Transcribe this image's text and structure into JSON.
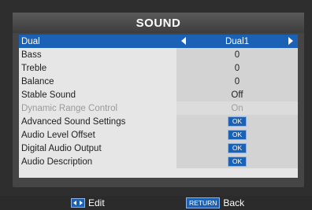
{
  "menu": {
    "title": "SOUND",
    "items": [
      {
        "label": "Dual",
        "value": "Dual1"
      },
      {
        "label": "Bass",
        "value": "0"
      },
      {
        "label": "Treble",
        "value": "0"
      },
      {
        "label": "Balance",
        "value": "0"
      },
      {
        "label": "Stable Sound",
        "value": "Off"
      },
      {
        "label": "Dynamic Range Control",
        "value": "On"
      },
      {
        "label": "Advanced Sound Settings",
        "value": "OK"
      },
      {
        "label": "Audio Level Offset",
        "value": "OK"
      },
      {
        "label": "Digital Audio Output",
        "value": "OK"
      },
      {
        "label": "Audio Description",
        "value": "OK"
      }
    ]
  },
  "footer": {
    "edit_label": "Edit",
    "return_key": "RETURN",
    "back_label": "Back"
  },
  "colors": {
    "selection": "#1b62b7",
    "panel": "#454545",
    "menu_bg": "#e6e6e6"
  }
}
